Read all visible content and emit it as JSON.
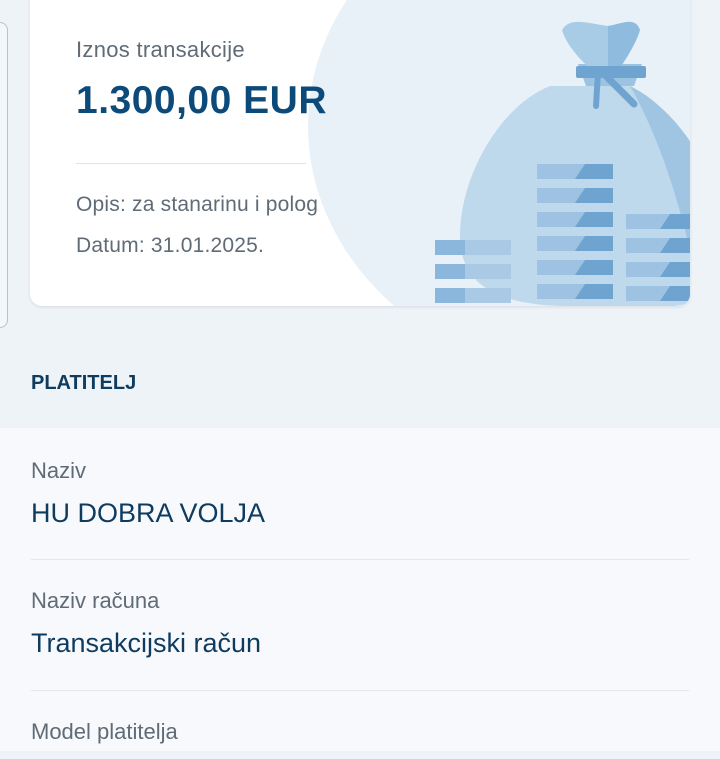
{
  "transaction": {
    "amount_label": "Iznos transakcije",
    "amount": "1.300,00 EUR",
    "description": "Opis: za stanarinu i polog",
    "date": "Datum: 31.01.2025."
  },
  "payer_section": {
    "title": "PLATITELJ",
    "fields": [
      {
        "label": "Naziv",
        "value": "HU DOBRA VOLJA"
      },
      {
        "label": "Naziv računa",
        "value": "Transakcijski račun"
      },
      {
        "label": "Model platitelja",
        "value": ""
      }
    ]
  },
  "colors": {
    "background": "#eef3f8",
    "card": "#ffffff",
    "primary_text": "#0e3b5e",
    "amount_text": "#0c4a7a",
    "muted_text": "#5f6b76",
    "illustration_blue": "#7fb0d8"
  },
  "icons": {
    "illustration": "money-bag-with-coin-stacks"
  }
}
